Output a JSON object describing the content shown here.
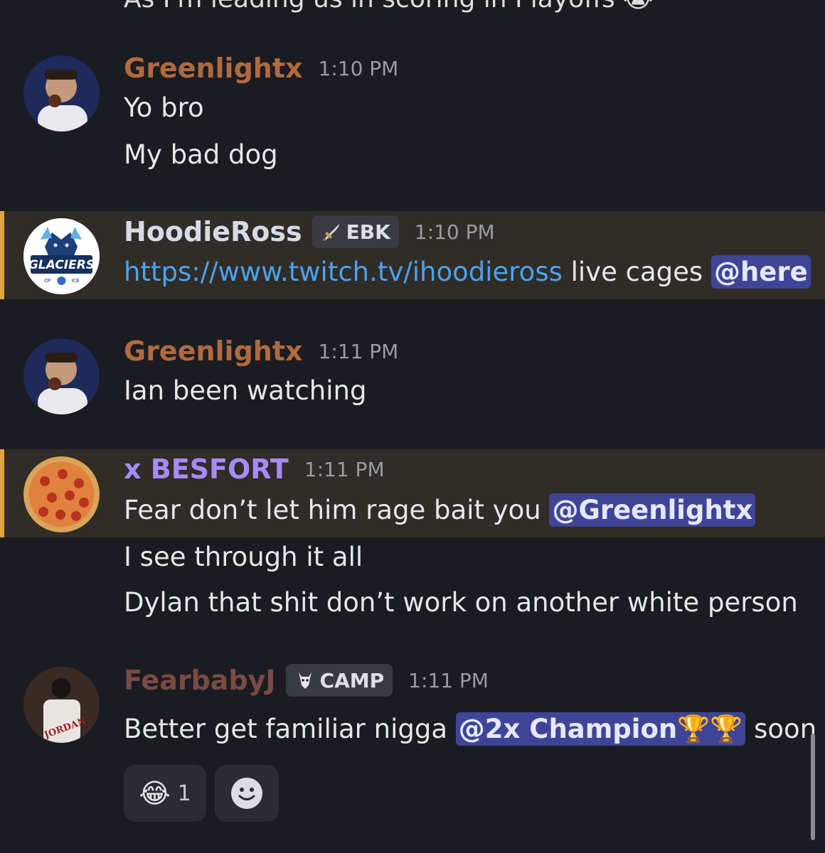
{
  "top_partial": "As I'm leading us in scoring in Playoffs 😭",
  "messages": [
    {
      "author": "Greenlightx",
      "time": "1:10 PM",
      "lines": [
        "Yo bro",
        "My bad dog"
      ]
    },
    {
      "author": "HoodieRoss",
      "badge": "EBK",
      "time": "1:10 PM",
      "link": "https://www.twitch.tv/ihoodieross",
      "after_link": " live cages ",
      "mention": "@here",
      "avatar_text": "GLACIERS",
      "avatar_sub_left": "OF",
      "avatar_sub_right": "ICE"
    },
    {
      "author": "Greenlightx",
      "time": "1:11 PM",
      "lines": [
        "Ian been watching"
      ]
    },
    {
      "author": "x BESFORT",
      "time": "1:11 PM",
      "line1_text": "Fear don’t let him rage bait you ",
      "line1_mention": "@Greenlightx",
      "lines": [
        "I see through it all",
        "Dylan that shit don’t work on another white person"
      ]
    },
    {
      "author": "FearbabyJ",
      "badge": "CAMP",
      "time": "1:11 PM",
      "text_before": "Better get familiar nigga ",
      "mention": "@2x Champion🏆🏆",
      "text_after": " soon",
      "avatar_text": "JORDAN"
    }
  ],
  "reactions": [
    {
      "emoji": "😂",
      "count": "1"
    },
    {
      "emoji": "☻",
      "count": ""
    }
  ],
  "colors": {
    "greenlightx": "#b06a3e",
    "hoodieross": "#d6dbe6",
    "besfort": "#a78bfa",
    "fearbabyj": "#7a4a44",
    "link": "#4aa3f0"
  }
}
